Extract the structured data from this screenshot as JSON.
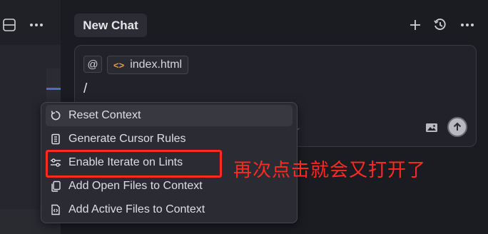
{
  "header": {
    "title": "New Chat",
    "left_icons": [
      "layout-icon",
      "more-icon"
    ],
    "right_icons": [
      "plus-icon",
      "history-icon",
      "more-icon"
    ]
  },
  "composer": {
    "mention_symbol": "@",
    "file_chip": {
      "icon": "code-icon",
      "label": "index.html"
    },
    "input_text": "/",
    "image_icon": "image-icon",
    "send_icon": "arrow-up-icon"
  },
  "menu": {
    "items": [
      {
        "icon": "refresh-icon",
        "label": "Reset Context",
        "active": true
      },
      {
        "icon": "rules-icon",
        "label": "Generate Cursor Rules",
        "active": false
      },
      {
        "icon": "sliders-icon",
        "label": "Enable Iterate on Lints",
        "active": false
      },
      {
        "icon": "copy-icon",
        "label": "Add Open Files to Context",
        "active": false
      },
      {
        "icon": "file-code-icon",
        "label": "Add Active Files to Context",
        "active": false
      }
    ]
  },
  "annotation": {
    "text": "再次点击就会又打开了",
    "color": "#ff2a1f"
  },
  "colors": {
    "background": "#1b1c21",
    "menu_bg": "#2b2c33",
    "accent_red": "#ff2a1f"
  }
}
